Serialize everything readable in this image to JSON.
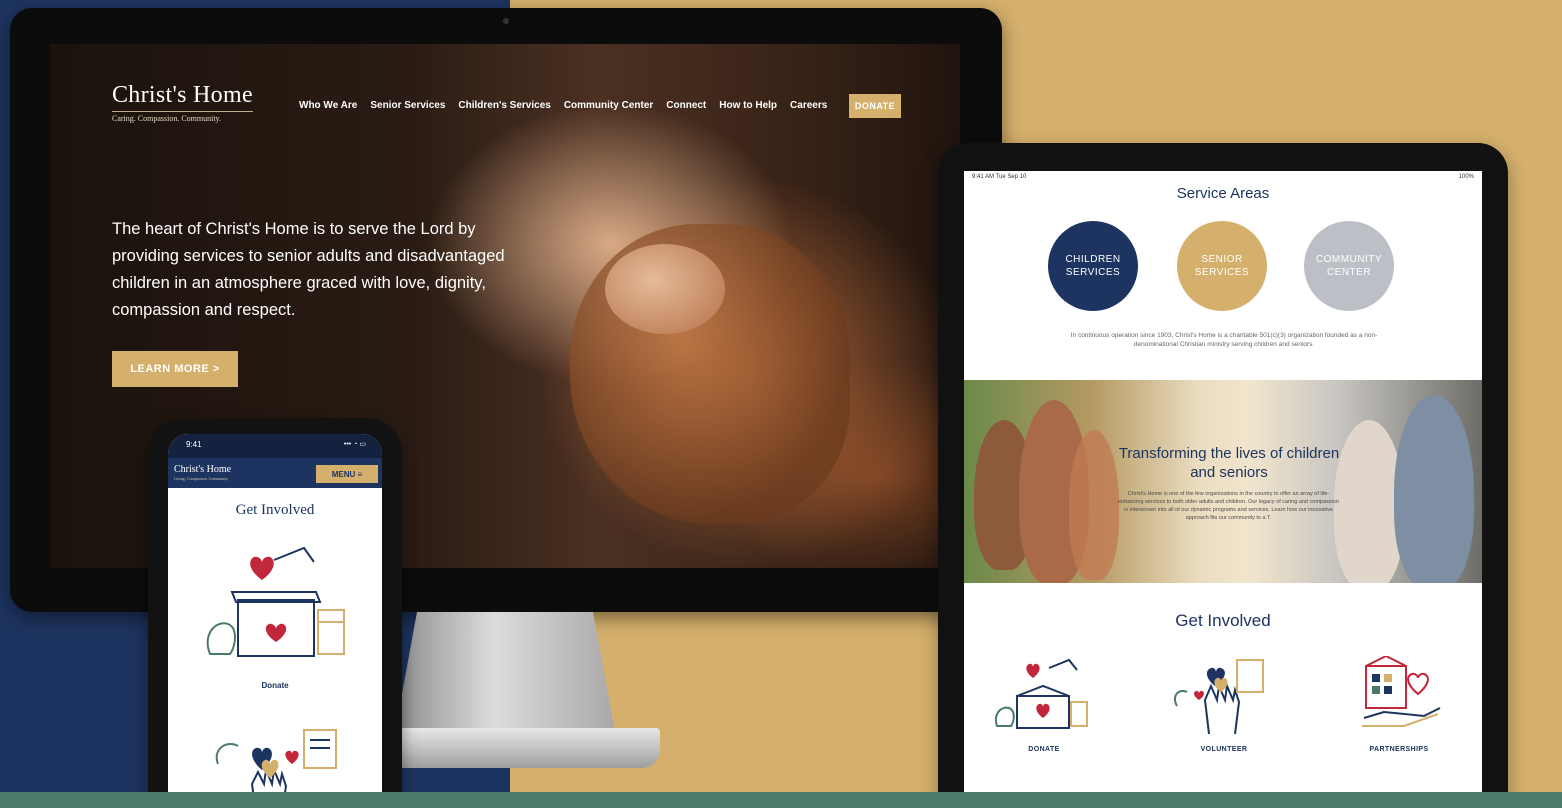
{
  "colors": {
    "navy": "#1d3460",
    "gold": "#d5b06c",
    "gray": "#bcbfc5",
    "red": "#c2263a",
    "green": "#4a7a6a"
  },
  "desktop": {
    "logo_name": "Christ's Home",
    "logo_tagline": "Caring. Compassion. Community.",
    "nav": [
      "Who We Are",
      "Senior Services",
      "Children's Services",
      "Community Center",
      "Connect",
      "How to Help",
      "Careers"
    ],
    "donate_label": "DONATE",
    "hero_text": "The heart of Christ's Home is to serve the Lord by providing services to senior adults and disadvantaged children in an atmosphere graced with love, dignity, compassion and respect.",
    "learn_more_label": "LEARN MORE >"
  },
  "tablet": {
    "status_time": "9:41 AM  Tue Sep 10",
    "status_battery": "100%",
    "service_areas_title": "Service Areas",
    "circles": [
      {
        "label": "CHILDREN SERVICES",
        "color": "#1d3460"
      },
      {
        "label": "SENIOR SERVICES",
        "color": "#d5b06c"
      },
      {
        "label": "COMMUNITY CENTER",
        "color": "#bcbfc5"
      }
    ],
    "service_description": "In continuous operation since 1903, Christ's Home is a charitable 501(c)(3) organization founded as a non-denominational Christian ministry serving children and seniors.",
    "banner_title": "Transforming the lives of children and seniors",
    "banner_text": "Christ's Home is one of the few organizations in the country to offer an array of life-enhancing services to both older adults and children. Our legacy of caring and compassion is interwoven into all of our dynamic programs and services. Learn how our innovative approach fits our community to a T.",
    "get_involved_title": "Get Involved",
    "tiles": [
      {
        "label": "DONATE",
        "icon": "donate-box-icon"
      },
      {
        "label": "VOLUNTEER",
        "icon": "volunteer-hands-icon"
      },
      {
        "label": "PARTNERSHIPS",
        "icon": "partnership-building-icon"
      }
    ]
  },
  "phone": {
    "time": "9:41",
    "signal": "••• ◔ ▭",
    "logo_name": "Christ's Home",
    "logo_tagline": "Caring. Compassion. Community.",
    "menu_label": "MENU ≡",
    "get_involved_title": "Get Involved",
    "donate_label": "Donate"
  }
}
